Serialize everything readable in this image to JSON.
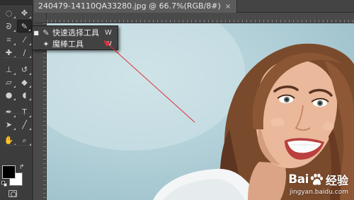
{
  "document": {
    "tab_title": "240479-14110QA33280.jpg @ 66.7%(RGB/8#)",
    "close_glyph": "×"
  },
  "toolbar": {
    "tools": [
      {
        "name": "marquee-icon",
        "glyph": "◌",
        "active": false
      },
      {
        "name": "move-icon",
        "glyph": "✥",
        "active": false
      },
      {
        "name": "lasso-icon",
        "glyph": "ᘐ",
        "active": false
      },
      {
        "name": "quick-selection-icon",
        "glyph": "✎",
        "active": true
      },
      {
        "name": "crop-icon",
        "glyph": "⌗",
        "active": false
      },
      {
        "name": "eyedropper-icon",
        "glyph": "⁄",
        "active": false
      },
      {
        "name": "healing-brush-icon",
        "glyph": "✚",
        "active": false
      },
      {
        "name": "brush-icon",
        "glyph": "∕",
        "active": false
      },
      {
        "name": "clone-stamp-icon",
        "glyph": "⊥",
        "active": false
      },
      {
        "name": "history-brush-icon",
        "glyph": "↺",
        "active": false
      },
      {
        "name": "eraser-icon",
        "glyph": "▱",
        "active": false
      },
      {
        "name": "paint-bucket-icon",
        "glyph": "◆",
        "active": false
      },
      {
        "name": "blur-icon",
        "glyph": "●",
        "active": false
      },
      {
        "name": "dodge-icon",
        "glyph": "◖",
        "active": false
      },
      {
        "name": "pen-icon",
        "glyph": "✒",
        "active": false
      },
      {
        "name": "type-icon",
        "glyph": "T",
        "active": false
      },
      {
        "name": "path-selection-icon",
        "glyph": "➤",
        "active": false
      },
      {
        "name": "line-tool-icon",
        "glyph": "╱",
        "active": false
      },
      {
        "name": "hand-icon",
        "glyph": "✋",
        "active": false
      },
      {
        "name": "zoom-icon",
        "glyph": "⌕",
        "active": false
      }
    ],
    "foreground_color": "#000000",
    "background_color": "#ffffff",
    "swap_glyph": "↱"
  },
  "flyout": {
    "items": [
      {
        "name": "quick-selection-tool-item",
        "label": "快速选择工具",
        "shortcut": "W",
        "selected": true,
        "glyph": "✎"
      },
      {
        "name": "magic-wand-tool-item",
        "label": "魔棒工具",
        "shortcut": "W",
        "selected": false,
        "glyph": "✦"
      }
    ],
    "selected_mark": "■"
  },
  "annotation": {
    "color": "#e0303a"
  },
  "watermark": {
    "logo_left": "Bai",
    "logo_right": "经验",
    "url": "jingyan.baidu.com"
  },
  "colors": {
    "panel": "#3c3c3c",
    "canvas_bg": "#535353",
    "photo_background": "#b2d0d8"
  }
}
